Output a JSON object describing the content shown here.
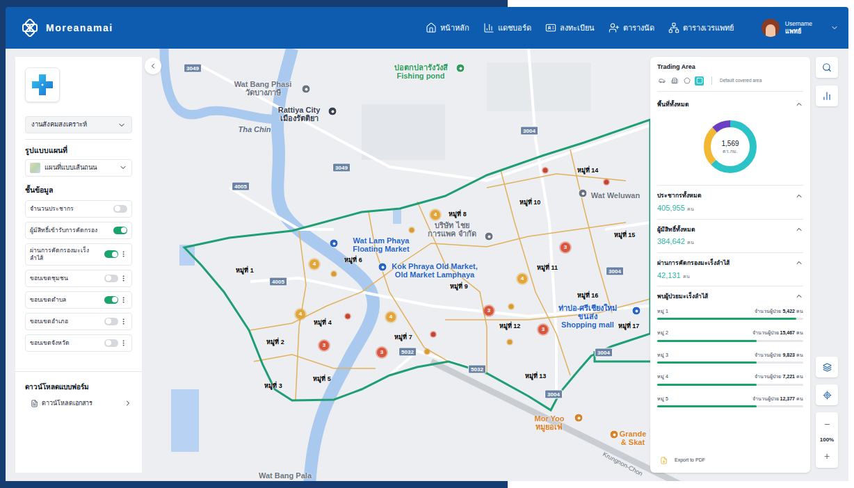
{
  "header": {
    "brand": "Moreanamai",
    "nav": [
      {
        "label": "หน้าหลัก"
      },
      {
        "label": "แดชบอร์ด"
      },
      {
        "label": "ลงทะเบียน"
      },
      {
        "label": "ตารางนัด"
      },
      {
        "label": "ตารางเวรแพทย์"
      }
    ],
    "user": {
      "name": "Username",
      "role": "แพทย์"
    }
  },
  "left_panel": {
    "department": "งานสังคมสงเคราะห์",
    "map_style_label": "รูปแบบแผนที่",
    "map_style": "แผนที่แบบเส้นถนน",
    "layers_label": "ชั้นข้อมูล",
    "layers": [
      {
        "label": "จำนวนประชากร",
        "on": false,
        "kind": "toggle"
      },
      {
        "label": "ผู้มีสิทธิ์เข้ารับการคัดกรอง",
        "on": true,
        "kind": "toggle"
      },
      {
        "label": "ผ่านการคัดกรองมะเร็งลำไส้",
        "on": true,
        "kind": "menu"
      },
      {
        "label": "ขอบเขตชุมชน",
        "on": false,
        "kind": "menu"
      },
      {
        "label": "ขอบเขตตำบล",
        "on": true,
        "kind": "menu"
      },
      {
        "label": "ขอบเขตอำเภอ",
        "on": false,
        "kind": "menu"
      },
      {
        "label": "ขอบเขตจังหวัด",
        "on": false,
        "kind": "menu"
      }
    ],
    "download_label": "ดาวน์โหลดแบบฟอร์ม",
    "download_item": "ดาวน์โหลดเอกสาร"
  },
  "right_panel": {
    "title": "Trading Area",
    "modes": [
      {
        "selected": false
      },
      {
        "selected": false
      },
      {
        "selected": false
      },
      {
        "selected": true
      }
    ],
    "mode_caption": "Default covered area",
    "area": {
      "title": "พื้นที่ทั้งหมด",
      "expanded": true,
      "value": "1,569",
      "unit": "ตร.กม.",
      "values": [
        63,
        25,
        12
      ],
      "colors": [
        "#2cc3c7",
        "#f2b834",
        "#6b3fc4"
      ]
    },
    "stats": [
      {
        "title": "ประชากรทั้งหมด",
        "value": "405,955",
        "unit": "คน",
        "expanded": true
      },
      {
        "title": "ผู้มีสิทธิ์ทั้งหมด",
        "value": "384,642",
        "unit": "คน",
        "expanded": true
      },
      {
        "title": "ผ่านการคัดกรองมะเร็งลำไส้",
        "value": "42,131",
        "unit": "คน",
        "expanded": true
      }
    ],
    "patients": {
      "title": "พบผู้ป่วยมะเร็งลำไส้",
      "expanded": true,
      "rows": [
        {
          "name": "หมู่ 1",
          "label": "จำนวนผู้ป่วย",
          "value": "5,422",
          "unit": "คน",
          "level": 0.95
        },
        {
          "name": "หมู่ 2",
          "label": "จำนวนผู้ป่วย",
          "value": "15,467",
          "unit": "คน",
          "level": 0.68
        },
        {
          "name": "หมู่ 3",
          "label": "จำนวนผู้ป่วย",
          "value": "9,823",
          "unit": "คน",
          "level": 0.68
        },
        {
          "name": "หมู่ 4",
          "label": "จำนวนผู้ป่วย",
          "value": "7,221",
          "unit": "คน",
          "level": 0.68
        },
        {
          "name": "หมู่ 5",
          "label": "จำนวนผู้ป่วย",
          "value": "12,377",
          "unit": "คน",
          "level": 0.68
        }
      ]
    },
    "export": "Export to PDF"
  },
  "toolbar": {
    "zoom_out": "−",
    "zoom": "100%",
    "zoom_in": "+"
  },
  "map": {
    "villages": [
      "หมู่ที่ 1",
      "หมู่ที่ 2",
      "หมู่ที่ 3",
      "หมู่ที่ 4",
      "หมู่ที่ 5",
      "หมู่ที่ 6",
      "หมู่ที่ 7",
      "หมู่ที่ 8",
      "หมู่ที่ 9",
      "หมู่ที่ 10",
      "หมู่ที่ 11",
      "หมู่ที่ 12",
      "หมู่ที่ 13",
      "หมู่ที่ 14",
      "หมู่ที่ 15",
      "หมู่ที่ 16",
      "หมู่ที่ 17"
    ],
    "markers": [
      {
        "kind": "numbered",
        "label": "4",
        "color": "#e2a53a"
      },
      {
        "kind": "numbered",
        "label": "4",
        "color": "#e2a53a"
      },
      {
        "kind": "numbered",
        "label": "4",
        "color": "#e2a53a"
      },
      {
        "kind": "numbered",
        "label": "4",
        "color": "#e2a53a"
      },
      {
        "kind": "numbered",
        "label": "4",
        "color": "#e2a53a"
      },
      {
        "kind": "numbered",
        "label": "3",
        "color": "#d9553c"
      },
      {
        "kind": "numbered",
        "label": "3",
        "color": "#d9553c"
      },
      {
        "kind": "numbered",
        "label": "3",
        "color": "#d9553c"
      },
      {
        "kind": "numbered",
        "label": "3",
        "color": "#d9553c"
      },
      {
        "kind": "numbered",
        "label": "3",
        "color": "#d9553c"
      },
      {
        "kind": "dot",
        "color": "#c9432e"
      },
      {
        "kind": "dot",
        "color": "#c9432e"
      },
      {
        "kind": "dot",
        "color": "#c9432e"
      },
      {
        "kind": "dot",
        "color": "#c9432e"
      },
      {
        "kind": "dot",
        "color": "#d99a2e"
      },
      {
        "kind": "dot",
        "color": "#d99a2e"
      },
      {
        "kind": "dot",
        "color": "#d99a2e"
      },
      {
        "kind": "dot",
        "color": "#d99a2e"
      },
      {
        "kind": "dot",
        "color": "#d99a2e"
      }
    ],
    "roads": [
      "3049",
      "3049",
      "4005",
      "4005",
      "3004",
      "3004",
      "3004",
      "3004",
      "5032",
      "5032"
    ],
    "places": [
      {
        "lines": [
          "บ่อตกปลารังวังสี",
          "Fishing pond"
        ],
        "color": "#2e9b5c"
      },
      {
        "lines": [
          "Wat Bang Phasi",
          "วัดบางภาษี"
        ],
        "color": "#6b7280"
      },
      {
        "lines": [
          "Rattiya City",
          "เมืองรัตติยา"
        ],
        "color": "#374151"
      },
      {
        "lines": [
          "Tha Chin"
        ],
        "color": "#5a6a85"
      },
      {
        "lines": [
          "Wat Lam Phaya",
          "Floating Market"
        ],
        "color": "#2563c9"
      },
      {
        "lines": [
          "Kok Phraya Old Market,",
          "Old Market Lamphaya"
        ],
        "color": "#2563c9"
      },
      {
        "lines": [
          "บริษัท ไชย",
          "การแพค จำกัด"
        ],
        "color": "#6b7280"
      },
      {
        "lines": [
          "Wat Weluwan"
        ],
        "color": "#6b7280"
      },
      {
        "lines": [
          "ท่าบ่อ-ศรีเชียงใหม่",
          "ขนส่ง",
          "Shopping mall"
        ],
        "color": "#2563c9"
      },
      {
        "lines": [
          "Mor Yoo",
          "หมูยอเฟ่"
        ],
        "color": "#d9822b"
      },
      {
        "lines": [
          "Grande",
          "& Skat"
        ],
        "color": "#d9822b"
      },
      {
        "lines": [
          "Wat Bang Pala"
        ],
        "color": "#6b7280"
      }
    ],
    "street": "Krungnon-Chon"
  }
}
